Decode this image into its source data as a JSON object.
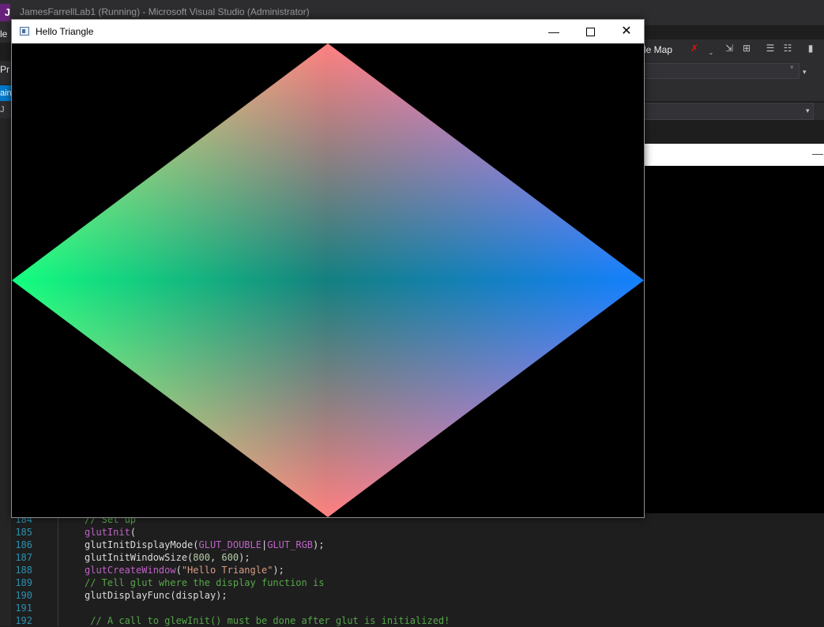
{
  "vs": {
    "logo": "J",
    "window_title": "JamesFarrellLab1 (Running) - Microsoft Visual Studio  (Administrator)",
    "menu_fragment": "le",
    "code_map_label": "le Map",
    "toolbar_fragment": "Pr",
    "tab_fragment": "ain",
    "nav_fragment": "J"
  },
  "editor": {
    "lines": [
      {
        "num": "184",
        "parts": [
          {
            "c": "cm",
            "t": "// Set up"
          }
        ]
      },
      {
        "num": "185",
        "parts": [
          {
            "c": "mac",
            "t": "glutInit"
          },
          {
            "c": "",
            "t": "("
          }
        ]
      },
      {
        "num": "186",
        "parts": [
          {
            "c": "",
            "t": "glutInitDisplayMode("
          },
          {
            "c": "mac",
            "t": "GLUT_DOUBLE"
          },
          {
            "c": "",
            "t": "|"
          },
          {
            "c": "mac",
            "t": "GLUT_RGB"
          },
          {
            "c": "",
            "t": ");"
          }
        ]
      },
      {
        "num": "187",
        "parts": [
          {
            "c": "",
            "t": "glutInitWindowSize("
          },
          {
            "c": "num",
            "t": "800"
          },
          {
            "c": "",
            "t": ", "
          },
          {
            "c": "num",
            "t": "600"
          },
          {
            "c": "",
            "t": ");"
          }
        ]
      },
      {
        "num": "188",
        "parts": [
          {
            "c": "mac",
            "t": "glutCreateWindow"
          },
          {
            "c": "",
            "t": "("
          },
          {
            "c": "str",
            "t": "\"Hello Triangle\""
          },
          {
            "c": "",
            "t": ");"
          }
        ]
      },
      {
        "num": "189",
        "parts": [
          {
            "c": "cm",
            "t": "// Tell glut where the display function is"
          }
        ]
      },
      {
        "num": "190",
        "parts": [
          {
            "c": "",
            "t": "glutDisplayFunc(display);"
          }
        ]
      },
      {
        "num": "191",
        "parts": []
      },
      {
        "num": "192",
        "parts": [
          {
            "c": "cm",
            "t": " // A call to glewInit() must be done after glut is initialized!"
          }
        ]
      }
    ]
  },
  "gl_window": {
    "title": "Hello Triangle",
    "minimize_glyph": "—",
    "close_glyph": "✕",
    "diamond": {
      "top_color": "#ff0000",
      "left_color": "#00ff00",
      "right_color": "#0000ff",
      "bottom_color": "#ff0000"
    }
  },
  "colors": {
    "vs_background": "#1e1e1e",
    "vs_chrome": "#2d2d30",
    "vs_accent": "#007acc",
    "canvas_background": "#000000"
  }
}
